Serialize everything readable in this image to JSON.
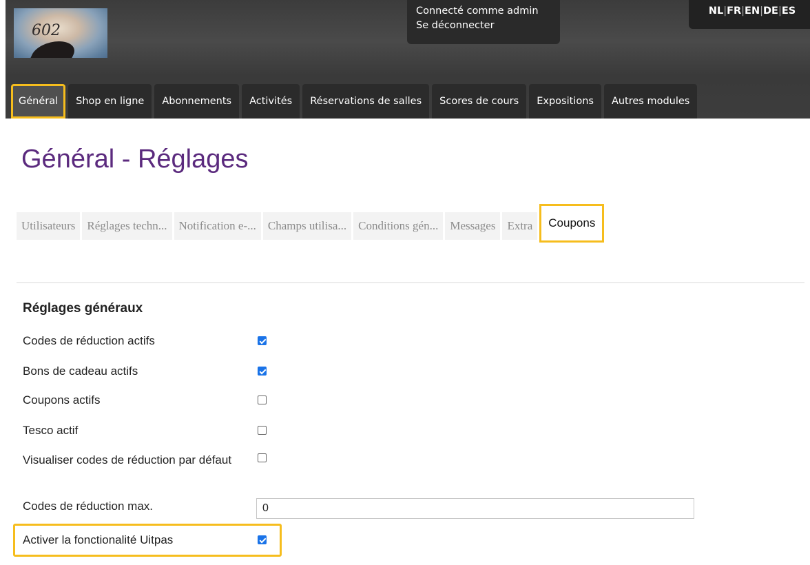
{
  "header": {
    "logo_text": "602",
    "user": {
      "logged_in_as": "Connecté comme admin",
      "logout": "Se déconnecter"
    },
    "languages": [
      "NL",
      "FR",
      "EN",
      "DE",
      "ES"
    ]
  },
  "nav": {
    "items": [
      {
        "label": "Général",
        "active": true
      },
      {
        "label": "Shop en ligne"
      },
      {
        "label": "Abonnements"
      },
      {
        "label": "Activités"
      },
      {
        "label": "Réservations de salles"
      },
      {
        "label": "Scores de cours"
      },
      {
        "label": "Expositions"
      },
      {
        "label": "Autres modules"
      }
    ]
  },
  "page": {
    "title": "Général - Réglages"
  },
  "subtabs": {
    "items": [
      {
        "label": "Utilisateurs"
      },
      {
        "label": "Réglages techn..."
      },
      {
        "label": "Notification e-..."
      },
      {
        "label": "Champs utilisa..."
      },
      {
        "label": "Conditions gén..."
      },
      {
        "label": "Messages"
      },
      {
        "label": "Extra"
      },
      {
        "label": "Coupons",
        "active": true
      }
    ]
  },
  "settings": {
    "section_title": "Réglages généraux",
    "rows": [
      {
        "label": "Codes de réduction actifs",
        "checked": true
      },
      {
        "label": "Bons de cadeau actifs",
        "checked": true
      },
      {
        "label": "Coupons actifs",
        "checked": false
      },
      {
        "label": "Tesco actif",
        "checked": false
      },
      {
        "label": "Visualiser codes de réduction par défaut",
        "checked": false
      },
      {
        "label": "Codes de réduction max.",
        "value": "0"
      },
      {
        "label": "Activer la fonctionalité Uitpas",
        "checked": true
      }
    ]
  },
  "colors": {
    "header_bg": "#3c3c3c",
    "title_purple": "#5b2a7e",
    "highlight": "#f6bd1d",
    "checkbox_blue": "#1a73e8"
  }
}
